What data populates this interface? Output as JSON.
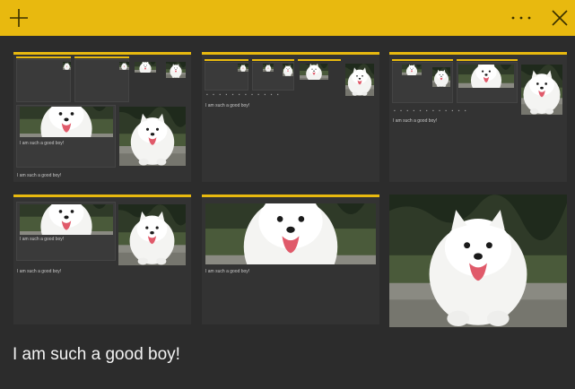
{
  "titlebar": {
    "background": "#e8b90f",
    "add_icon": "plus-icon",
    "more_icon": "ellipsis-icon",
    "close_icon": "close-icon"
  },
  "cards": [
    {
      "caption": "I am such a good boy!",
      "inner_caption": "I am such a good boy!",
      "mini_caption": "I am such a good boy!"
    },
    {
      "caption": "I am such a good boy!",
      "inner_caption": ""
    },
    {
      "caption": "I am such a good boy!",
      "inner_caption": ""
    },
    {
      "caption": "I am such a good boy!",
      "inner_caption": "I am such a good boy!"
    },
    {
      "caption": "I am such a good boy!"
    },
    {
      "caption": ""
    }
  ],
  "note": {
    "text": "I am such a good boy!"
  },
  "colors": {
    "accent": "#e8b90f",
    "background": "#2c2c2c",
    "card": "#333333"
  }
}
